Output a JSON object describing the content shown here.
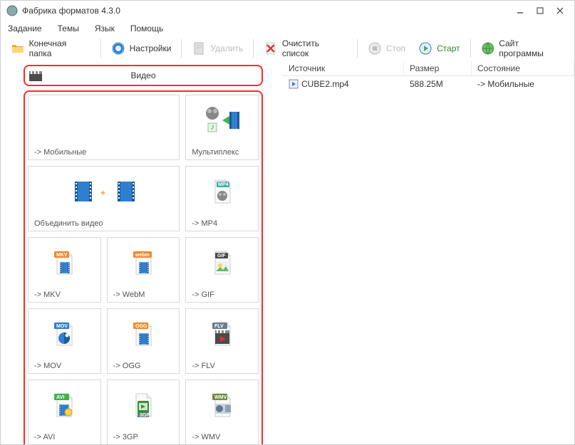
{
  "window": {
    "title": "Фабрика форматов 4.3.0"
  },
  "menu": {
    "items": [
      "Задание",
      "Темы",
      "Язык",
      "Помощь"
    ]
  },
  "toolbar": {
    "dest_folder": "Конечная папка",
    "settings": "Настройки",
    "delete": "Удалить",
    "clear_list": "Очистить список",
    "stop": "Стоп",
    "start": "Старт",
    "site": "Сайт программы"
  },
  "category": {
    "label": "Видео"
  },
  "formats": [
    {
      "label": "-> Мобильные",
      "icon": "none",
      "wide": true
    },
    {
      "label": "Мультиплекс",
      "icon": "mux"
    },
    {
      "label": "Объединить видео",
      "icon": "merge",
      "wide": true
    },
    {
      "label": "-> MP4",
      "icon": "mp4"
    },
    {
      "label": "-> MKV",
      "icon": "mkv"
    },
    {
      "label": "-> WebM",
      "icon": "webm"
    },
    {
      "label": "-> GIF",
      "icon": "gif"
    },
    {
      "label": "-> MOV",
      "icon": "mov"
    },
    {
      "label": "-> OGG",
      "icon": "ogg"
    },
    {
      "label": "-> FLV",
      "icon": "flv"
    },
    {
      "label": "-> AVI",
      "icon": "avi"
    },
    {
      "label": "-> 3GP",
      "icon": "3gp"
    },
    {
      "label": "-> WMV",
      "icon": "wmv"
    }
  ],
  "list": {
    "headers": {
      "source": "Источник",
      "size": "Размер",
      "state": "Состояние"
    },
    "rows": [
      {
        "source": "CUBE2.mp4",
        "size": "588.25M",
        "state": "-> Мобильные"
      }
    ]
  }
}
